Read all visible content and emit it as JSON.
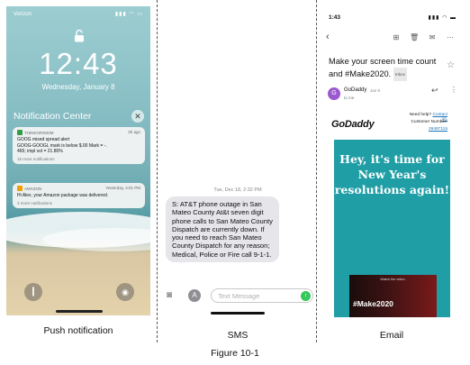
{
  "lock_screen": {
    "carrier": "Verizon",
    "time": "12:43",
    "date": "Wednesday, January 8",
    "notification_center_title": "Notification Center",
    "notifications": [
      {
        "app": "THINKORSWIM",
        "age": "2h ago",
        "lines": [
          "GOOG mixed spread alert",
          "GOOG-GOOGL mark is below $.00 Mark = -.",
          "465; impl vol = 21.80%"
        ],
        "more": "15 more notifications",
        "app_color": "#2e9d43"
      },
      {
        "app": "AMAZON",
        "age": "Yesterday, 4:01 PM",
        "lines": [
          "Hi Alex, your Amazon package was delivered."
        ],
        "more": "3 more notifications",
        "app_color": "#f0a000"
      }
    ],
    "icons": {
      "lock": "lock-open-icon",
      "flashlight": "flashlight-icon",
      "camera": "camera-icon",
      "close": "close-icon"
    }
  },
  "sms": {
    "timestamp": "Tue, Dec 18, 2:32 PM",
    "message": "S: AT&T phone outage in San Mateo County At&t seven digit phone calls to San Mateo County Dispatch are currently down.  If you need to reach San Mateo County Dispatch for any reason; Medical, Police or Fire call 9-1-1.",
    "input_placeholder": "Text Message",
    "send_color": "#34c759",
    "icons": {
      "camera": "camera-icon",
      "apps": "app-store-icon",
      "send": "send-arrow-icon"
    }
  },
  "email": {
    "clock": "1:43",
    "subject": "Make your screen time count and #Make2020.",
    "label_chip": "Inbox",
    "sender": "GoDaddy",
    "sender_date": "Jan 8",
    "to_line": "to me",
    "avatar_letter": "G",
    "avatar_color": "#9b59d0",
    "brand": "GoDaddy",
    "help_text": "Need help?",
    "contact_link": "Contact us.",
    "phone_label": "Customer Number:",
    "phone_number": "29497115",
    "hero_text": "Hey, it's time for New Year's resolutions again!",
    "hero_color": "#1f9ea6",
    "video_label": "Watch the video.",
    "video_tag": "#Make2020",
    "icons": {
      "back": "back-arrow-icon",
      "archive": "archive-icon",
      "delete": "trash-icon",
      "mail": "mail-icon",
      "overflow": "more-icon",
      "star": "star-icon",
      "reply": "reply-icon"
    }
  },
  "captions": {
    "push": "Push notification",
    "sms": "SMS",
    "email": "Email",
    "figure": "Figure 10-1"
  }
}
